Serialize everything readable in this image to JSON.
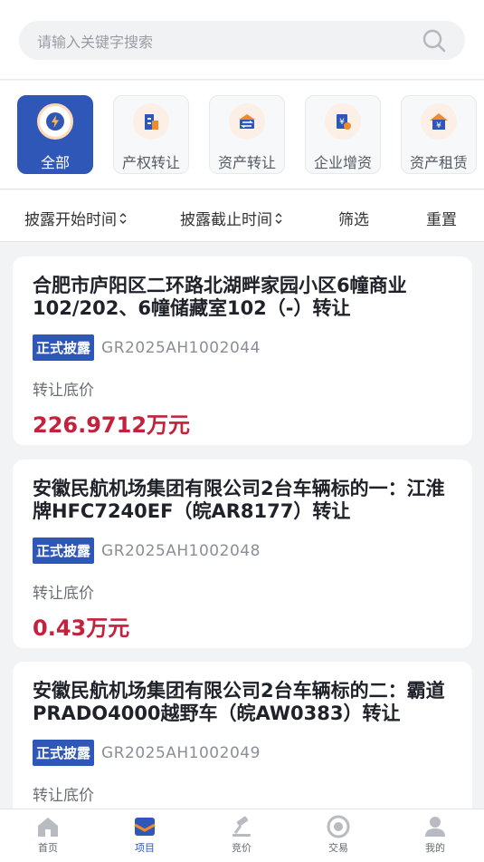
{
  "search": {
    "placeholder": "请输入关键字搜索"
  },
  "categories": [
    {
      "label": "全部",
      "icon": "lightning-icon",
      "active": true
    },
    {
      "label": "产权转让",
      "icon": "building-icon",
      "active": false
    },
    {
      "label": "资产转让",
      "icon": "transfer-icon",
      "active": false
    },
    {
      "label": "企业增资",
      "icon": "capital-increase-icon",
      "active": false
    },
    {
      "label": "资产租赁",
      "icon": "house-yen-icon",
      "active": false
    }
  ],
  "filters": {
    "start_time": "披露开始时间",
    "end_time": "披露截止时间",
    "filter": "筛选",
    "reset": "重置"
  },
  "listings": [
    {
      "title": "合肥市庐阳区二环路北湖畔家园小区6幢商业102/202、6幢储藏室102（-）转让",
      "badge": "正式披露",
      "code": "GR2025AH1002044",
      "price_label": "转让底价",
      "price": "226.9712万元"
    },
    {
      "title": "安徽民航机场集团有限公司2台车辆标的一：江淮牌HFC7240EF（皖AR8177）转让",
      "badge": "正式披露",
      "code": "GR2025AH1002048",
      "price_label": "转让底价",
      "price": "0.43万元"
    },
    {
      "title": "安徽民航机场集团有限公司2台车辆标的二：霸道PRADO4000越野车（皖AW0383）转让",
      "badge": "正式披露",
      "code": "GR2025AH1002049",
      "price_label": "转让底价",
      "price": ""
    }
  ],
  "tabbar": [
    {
      "label": "首页",
      "icon": "home-icon"
    },
    {
      "label": "项目",
      "icon": "project-icon",
      "active": true
    },
    {
      "label": "竞价",
      "icon": "gavel-icon"
    },
    {
      "label": "交易",
      "icon": "trade-icon"
    },
    {
      "label": "我的",
      "icon": "user-icon"
    }
  ],
  "colors": {
    "accent": "#2f57b8",
    "price": "#c4213c",
    "icon_orange": "#f08a2c"
  }
}
